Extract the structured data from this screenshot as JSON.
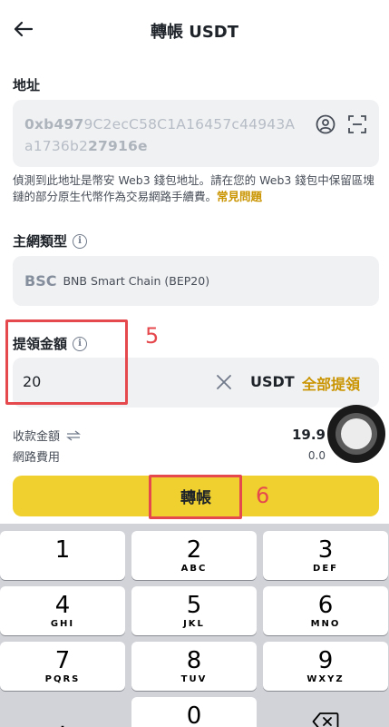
{
  "header": {
    "title": "轉帳 USDT"
  },
  "address": {
    "label": "地址",
    "value_part1": "0xb497",
    "value_part2": "9C2ecC58C1A16457c44943Aa1736b2",
    "value_part3": "27916e",
    "note_text": "偵測到此地址是幣安 Web3 錢包地址。請在您的 Web3 錢包中保留區塊鏈的部分原生代幣作為交易網路手續費。",
    "note_link": "常見問題"
  },
  "network": {
    "label": "主網類型",
    "code": "BSC",
    "name": "BNB Smart Chain (BEP20)"
  },
  "amount": {
    "label": "提領金額",
    "value": "20",
    "unit": "USDT",
    "max_label": "全部提領"
  },
  "summary": {
    "receive_label": "收款金額",
    "receive_value": "19.9",
    "fee_label": "網路費用",
    "fee_value": "0.0"
  },
  "submit": {
    "label": "轉帳"
  },
  "annotations": {
    "step5": "5",
    "step6": "6"
  },
  "keypad": {
    "keys": [
      {
        "digit": "1",
        "letters": ""
      },
      {
        "digit": "2",
        "letters": "ABC"
      },
      {
        "digit": "3",
        "letters": "DEF"
      },
      {
        "digit": "4",
        "letters": "GHI"
      },
      {
        "digit": "5",
        "letters": "JKL"
      },
      {
        "digit": "6",
        "letters": "MNO"
      },
      {
        "digit": "7",
        "letters": "PQRS"
      },
      {
        "digit": "8",
        "letters": "TUV"
      },
      {
        "digit": "9",
        "letters": "WXYZ"
      },
      {
        "digit": "0",
        "letters": ""
      }
    ],
    "dot": "."
  },
  "colors": {
    "accent": "#f0d02e",
    "link": "#c99400",
    "annotation": "#e5484d"
  }
}
